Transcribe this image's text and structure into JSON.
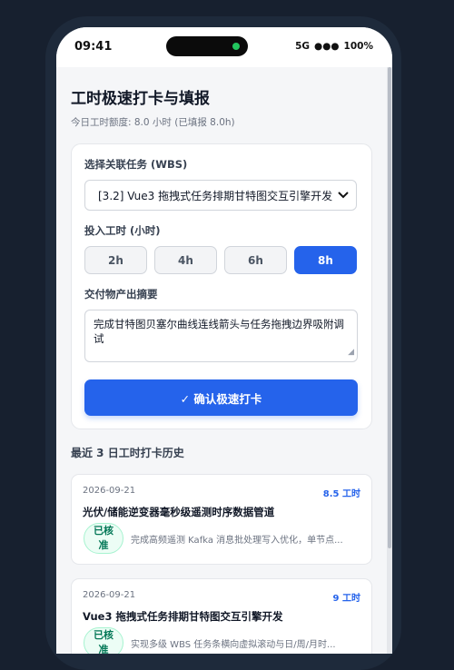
{
  "status_bar": {
    "time": "09:41",
    "network": "5G",
    "signal": "●●●",
    "battery": "100%"
  },
  "page": {
    "title": "工时极速打卡与填报",
    "subtitle": "今日工时额度: 8.0 小时 (已填报 8.0h)"
  },
  "form": {
    "task_label": "选择关联任务 (WBS)",
    "task_value": "[3.2] Vue3 拖拽式任务排期甘特图交互引擎开发",
    "hours_label": "投入工时 (小时)",
    "hour_options": [
      "2h",
      "4h",
      "6h",
      "8h"
    ],
    "selected_hours": "8h",
    "deliverable_label": "交付物产出摘要",
    "deliverable_text": "完成甘特图贝塞尔曲线连线箭头与任务拖拽边界吸附调试",
    "submit_label": "✓ 确认极速打卡"
  },
  "history": {
    "title": "最近 3 日工时打卡历史",
    "entries": [
      {
        "date": "2026-09-21",
        "hours": "8.5 工时",
        "task": "光伏/储能逆变器毫秒级遥测时序数据管道",
        "status": "已核准",
        "summary": "完成高频遥测 Kafka 消息批处理写入优化，单节点..."
      },
      {
        "date": "2026-09-21",
        "hours": "9 工时",
        "task": "Vue3 拖拽式任务排期甘特图交互引擎开发",
        "status": "已核准",
        "summary": "实现多级 WBS 任务条横向虚拟滚动与日/周/月时..."
      }
    ]
  },
  "colors": {
    "accent": "#2563eb",
    "approved": "#047857",
    "background": "#17202f"
  }
}
